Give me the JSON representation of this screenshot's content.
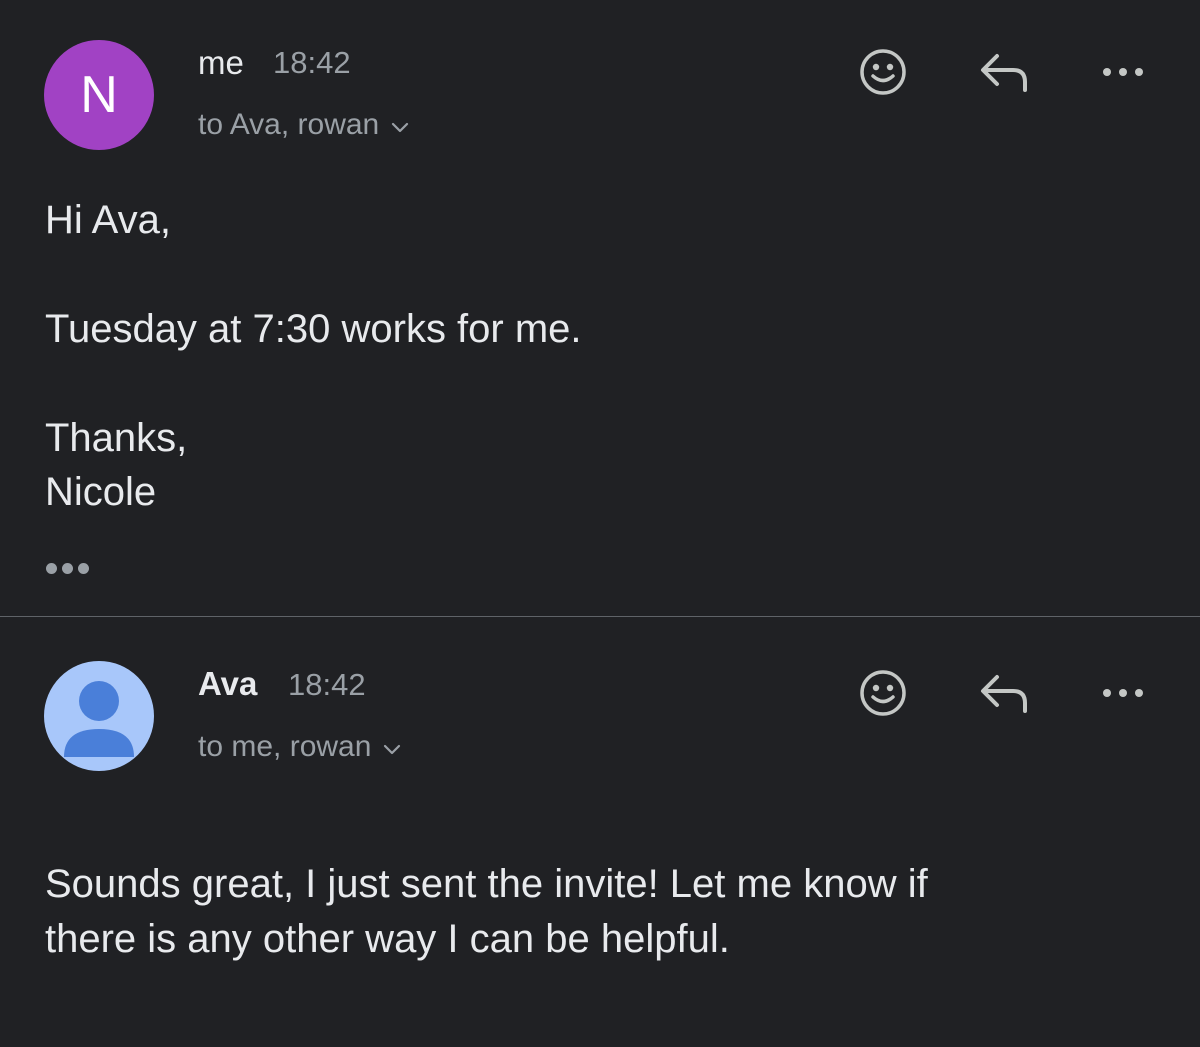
{
  "messages": [
    {
      "avatar_letter": "N",
      "avatar_color": "#a142c4",
      "sender": "me",
      "time": "18:42",
      "recipients": "to Ava, rowan",
      "body": {
        "greeting": "Hi Ava,",
        "line1": "Tuesday at 7:30 works for me.",
        "signoff": "Thanks,",
        "signature": "Nicole"
      },
      "actions": [
        "emoji-reaction-icon",
        "reply-icon",
        "more-options-icon"
      ],
      "trimmed_content": "show-trimmed-content-icon"
    },
    {
      "avatar_color": "#a8c7fa",
      "avatar_figure_color": "#4a7fd9",
      "sender": "Ava",
      "time": "18:42",
      "recipients": "to me, rowan",
      "body": {
        "line1": "Sounds great, I just sent the invite! Let me know if",
        "line2": "there is any other way I can be helpful."
      },
      "actions": [
        "emoji-reaction-icon",
        "reply-icon",
        "more-options-icon"
      ]
    }
  ],
  "colors": {
    "background": "#202124",
    "primary_text": "#e8eaed",
    "secondary_text": "#9aa0a6",
    "divider": "#5f6368"
  }
}
